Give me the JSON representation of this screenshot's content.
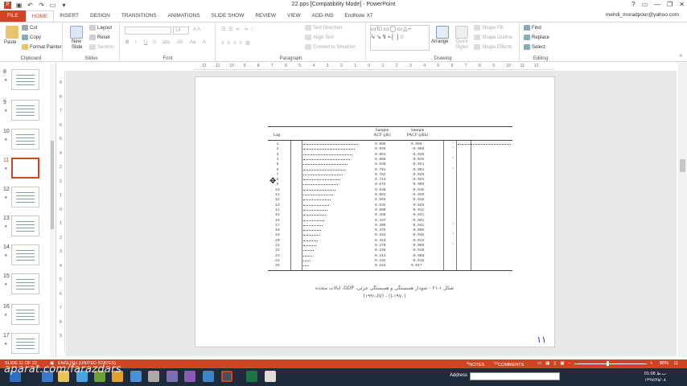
{
  "titlebar": {
    "title": "22.pps [Compatibility Mode] - PowerPoint",
    "help": "?",
    "minimize": "—",
    "restore": "❐",
    "close": "✕"
  },
  "tabs": {
    "file": "FILE",
    "items": [
      "HOME",
      "INSERT",
      "DESIGN",
      "TRANSITIONS",
      "ANIMATIONS",
      "SLIDE SHOW",
      "REVIEW",
      "VIEW",
      "ADD-INS",
      "EndNote X7"
    ],
    "active": "HOME",
    "user": "mehdi_moradpour@yahoo.com"
  },
  "ribbon": {
    "clipboard": {
      "paste": "Paste",
      "cut": "Cut",
      "copy": "Copy",
      "format_painter": "Format Painter",
      "label": "Clipboard"
    },
    "slides": {
      "new_slide": "New Slide",
      "layout": "Layout",
      "reset": "Reset",
      "section": "Section",
      "label": "Slides"
    },
    "font": {
      "size": "14",
      "label": "Font"
    },
    "paragraph": {
      "text_direction": "Text Direction",
      "align_text": "Align Text",
      "convert_smartart": "Convert to SmartArt",
      "label": "Paragraph"
    },
    "drawing": {
      "arrange": "Arrange",
      "quick_styles": "Quick Styles",
      "shape_fill": "Shape Fill",
      "shape_outline": "Shape Outline",
      "shape_effects": "Shape Effects",
      "label": "Drawing"
    },
    "editing": {
      "find": "Find",
      "replace": "Replace",
      "select": "Select",
      "label": "Editing"
    }
  },
  "thumbnails": [
    {
      "num": "8",
      "selected": false
    },
    {
      "num": "9",
      "selected": false
    },
    {
      "num": "10",
      "selected": false
    },
    {
      "num": "11",
      "selected": true
    },
    {
      "num": "12",
      "selected": false
    },
    {
      "num": "13",
      "selected": false
    },
    {
      "num": "14",
      "selected": false
    },
    {
      "num": "15",
      "selected": false
    },
    {
      "num": "16",
      "selected": false
    },
    {
      "num": "17",
      "selected": false
    }
  ],
  "ruler": {
    "h": [
      "12",
      "11",
      "10",
      "9",
      "8",
      "7",
      "6",
      "5",
      "4",
      "3",
      "2",
      "1",
      "0",
      "1",
      "2",
      "3",
      "4",
      "5",
      "6",
      "7",
      "8",
      "9",
      "10",
      "11",
      "12"
    ],
    "v": [
      "9",
      "8",
      "7",
      "6",
      "5",
      "4",
      "3",
      "2",
      "1",
      "0",
      "1",
      "2",
      "3",
      "4",
      "5",
      "6",
      "7",
      "8",
      "9"
    ]
  },
  "figure": {
    "headers": {
      "lag": "Lag",
      "acf": "Sample\nACF (ρ̂k)",
      "pacf": "Sample\nPACF (ρ̂kk)"
    },
    "rows": [
      {
        "lag": "1",
        "acf": "0.969",
        "pacf": "0.969",
        "acfLen": 68,
        "pacfLen": 66,
        "mark": "*"
      },
      {
        "lag": "2",
        "acf": "0.935",
        "pacf": "-0.058",
        "acfLen": 64,
        "pacfLen": 0,
        "mark": "*"
      },
      {
        "lag": "3",
        "acf": "0.901",
        "pacf": "-0.020",
        "acfLen": 61,
        "pacfLen": 0,
        "mark": ""
      },
      {
        "lag": "4",
        "acf": "0.866",
        "pacf": "-0.045",
        "acfLen": 58,
        "pacfLen": 0,
        "mark": "*"
      },
      {
        "lag": "5",
        "acf": "0.830",
        "pacf": "-0.024",
        "acfLen": 55,
        "pacfLen": 0,
        "mark": ""
      },
      {
        "lag": "6",
        "acf": "0.791",
        "pacf": "-0.062",
        "acfLen": 52,
        "pacfLen": 0,
        "mark": "*"
      },
      {
        "lag": "7",
        "acf": "0.752",
        "pacf": "-0.029",
        "acfLen": 49,
        "pacfLen": 0,
        "mark": ""
      },
      {
        "lag": "8",
        "acf": "0.713",
        "pacf": "-0.024",
        "acfLen": 46,
        "pacfLen": 0,
        "mark": ""
      },
      {
        "lag": "9",
        "acf": "0.675",
        "pacf": "-0.009",
        "acfLen": 43,
        "pacfLen": 0,
        "mark": ""
      },
      {
        "lag": "10",
        "acf": "0.638",
        "pacf": "-0.010",
        "acfLen": 40,
        "pacfLen": 0,
        "mark": ""
      },
      {
        "lag": "11",
        "acf": "0.601",
        "pacf": "-0.020",
        "acfLen": 37,
        "pacfLen": 0,
        "mark": ""
      },
      {
        "lag": "12",
        "acf": "0.565",
        "pacf": "-0.012",
        "acfLen": 34,
        "pacfLen": 0,
        "mark": ""
      },
      {
        "lag": "13",
        "acf": "0.532",
        "pacf": "-0.020",
        "acfLen": 32,
        "pacfLen": 0,
        "mark": ""
      },
      {
        "lag": "14",
        "acf": "0.500",
        "pacf": "-0.012",
        "acfLen": 30,
        "pacfLen": 0,
        "mark": ""
      },
      {
        "lag": "15",
        "acf": "0.468",
        "pacf": "-0.021",
        "acfLen": 28,
        "pacfLen": 0,
        "mark": ""
      },
      {
        "lag": "16",
        "acf": "0.437",
        "pacf": "-0.001",
        "acfLen": 26,
        "pacfLen": 0,
        "mark": ""
      },
      {
        "lag": "17",
        "acf": "0.405",
        "pacf": "-0.041",
        "acfLen": 24,
        "pacfLen": 0,
        "mark": "*"
      },
      {
        "lag": "18",
        "acf": "0.375",
        "pacf": "-0.005",
        "acfLen": 22,
        "pacfLen": 0,
        "mark": ""
      },
      {
        "lag": "19",
        "acf": "0.344",
        "pacf": "-0.036",
        "acfLen": 20,
        "pacfLen": 0,
        "mark": "*"
      },
      {
        "lag": "20",
        "acf": "0.313",
        "pacf": "-0.013",
        "acfLen": 18,
        "pacfLen": 0,
        "mark": ""
      },
      {
        "lag": "21",
        "acf": "0.279",
        "pacf": "-0.066",
        "acfLen": 16,
        "pacfLen": 0,
        "mark": "*"
      },
      {
        "lag": "22",
        "acf": "0.246",
        "pacf": "-0.019",
        "acfLen": 13,
        "pacfLen": 0,
        "mark": ""
      },
      {
        "lag": "23",
        "acf": "0.214",
        "pacf": "-0.008",
        "acfLen": 11,
        "pacfLen": 0,
        "mark": ""
      },
      {
        "lag": "24",
        "acf": "0.182",
        "pacf": "-0.018",
        "acfLen": 9,
        "pacfLen": 0,
        "mark": ""
      },
      {
        "lag": "25",
        "acf": "0.153",
        "pacf": "0.017",
        "acfLen": 7,
        "pacfLen": 0,
        "mark": ""
      }
    ]
  },
  "caption": {
    "line1": "شکل ۱-۲۱ - نمودار همبستگی و همبستگی جزئی، GDP، ایالات متحده",
    "line2": "(۱۹۷۰-I) - (۱۹۹۱-IV)"
  },
  "page_number": "۱۱",
  "status": {
    "slide": "SLIDE 11 OF 22",
    "language": "ENGLISH (UNITED STATES)",
    "notes": "NOTES",
    "comments": "COMMENTS",
    "zoom": "86%"
  },
  "taskbar": {
    "address": "Address",
    "time": "01:08 ب.ظ",
    "date": "۱۳۹۷/۲۵/۰۸"
  },
  "watermark": "aparat.com/farazdars",
  "colors": {
    "accent": "#d04423",
    "taskbar": "#1d2b3a"
  }
}
